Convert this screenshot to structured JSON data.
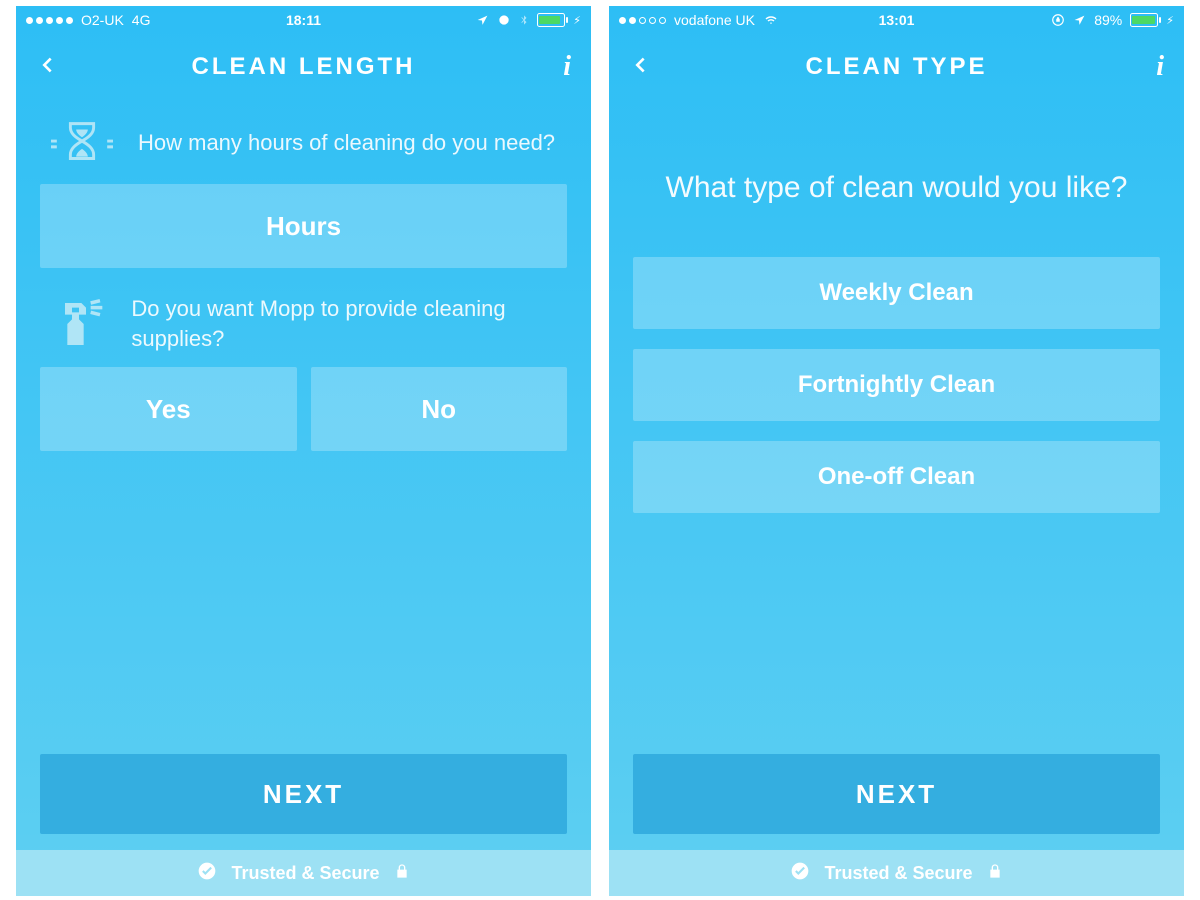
{
  "left": {
    "statusbar": {
      "carrier": "O2-UK",
      "network": "4G",
      "time": "18:11",
      "signal_filled": 5,
      "signal_total": 5,
      "location": true,
      "alarm": true,
      "bluetooth": true,
      "battery_fill_pct": 80,
      "charging": true
    },
    "nav": {
      "title": "CLEAN LENGTH"
    },
    "q1": "How many hours of cleaning do you need?",
    "hours_label": "Hours",
    "q2": "Do you want Mopp to provide cleaning supplies?",
    "yes": "Yes",
    "no": "No",
    "next": "NEXT",
    "footer": "Trusted & Secure"
  },
  "right": {
    "statusbar": {
      "carrier": "vodafone UK",
      "time": "13:01",
      "signal_filled": 2,
      "signal_total": 5,
      "wifi": true,
      "orientation_lock": true,
      "location": true,
      "battery_text": "89%",
      "battery_fill_pct": 89,
      "charging": true
    },
    "nav": {
      "title": "CLEAN TYPE"
    },
    "big_q": "What type of clean would you like?",
    "options": {
      "0": "Weekly Clean",
      "1": "Fortnightly Clean",
      "2": "One-off Clean"
    },
    "next": "NEXT",
    "footer": "Trusted & Secure"
  }
}
